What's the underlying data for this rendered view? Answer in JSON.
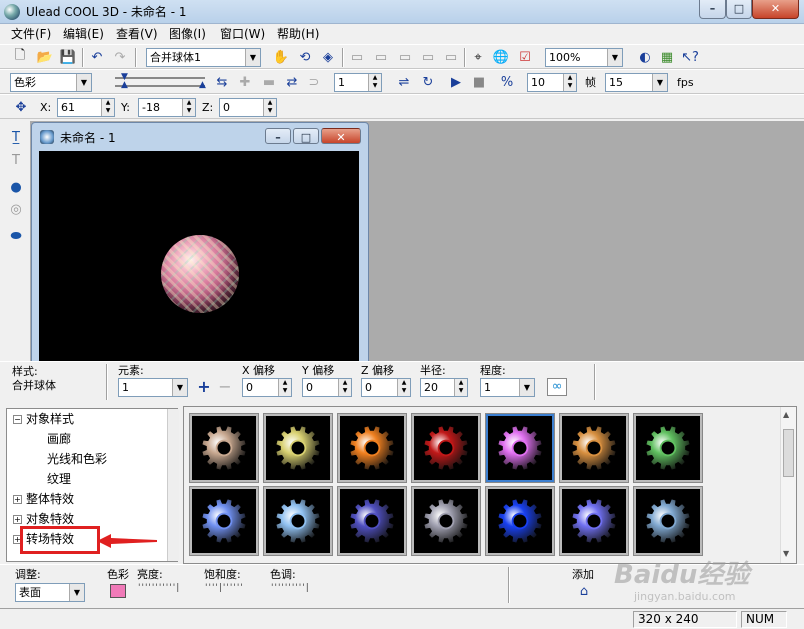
{
  "window": {
    "title": "Ulead COOL 3D - 未命名 - 1",
    "minimize": "–",
    "maximize": "□",
    "close": "✕"
  },
  "menu": [
    "文件(F)",
    "编辑(E)",
    "查看(V)",
    "图像(I)",
    "窗口(W)",
    "帮助(H)"
  ],
  "toolbar1": {
    "object_combo": "合并球体1",
    "zoom_combo": "100%"
  },
  "toolbar2": {
    "color_combo": "色彩",
    "frame_value": "1",
    "fps_value": "10",
    "frame_label": "帧",
    "frames_combo": "15",
    "fps_label": "fps"
  },
  "toolbar3": {
    "x_label": "X:",
    "x_value": "61",
    "y_label": "Y:",
    "y_value": "-18",
    "z_label": "Z:",
    "z_value": "0"
  },
  "document": {
    "title": "未命名 - 1"
  },
  "props": {
    "style_label": "样式:",
    "style_value": "合并球体",
    "element_label": "元素:",
    "element_value": "1",
    "x_offset_label": "X 偏移",
    "x_offset_value": "0",
    "y_offset_label": "Y 偏移",
    "y_offset_value": "0",
    "z_offset_label": "Z 偏移",
    "z_offset_value": "0",
    "radius_label": "半径:",
    "radius_value": "20",
    "degree_label": "程度:",
    "degree_value": "1"
  },
  "tree": {
    "root": "对象样式",
    "children": [
      "画廊",
      "光线和色彩",
      "纹理"
    ],
    "others": [
      "整体特效",
      "对象特效",
      "转场特效"
    ]
  },
  "thumbnails": {
    "rows": [
      [
        "#c8a890",
        "#d8d070",
        "#f08020",
        "#c01818",
        "#e070f0",
        "#d89040",
        "#60c060"
      ],
      [
        "#7090f0",
        "#90c0f0",
        "#5050c0",
        "#a0a0b0",
        "#1840f0",
        "#7070f0",
        "#80a8d0"
      ]
    ],
    "selected": [
      0,
      4
    ]
  },
  "bottom": {
    "adjust_label": "调整:",
    "adjust_value": "表面",
    "color_label": "色彩",
    "brightness_label": "亮度:",
    "saturation_label": "饱和度:",
    "hue_label": "色调:",
    "add_label": "添加",
    "swatch_color": "#f07ab8"
  },
  "status": {
    "size": "320 x 240",
    "num": "NUM"
  },
  "watermark": {
    "text": "Baidu经验",
    "url": "jingyan.baidu.com"
  }
}
